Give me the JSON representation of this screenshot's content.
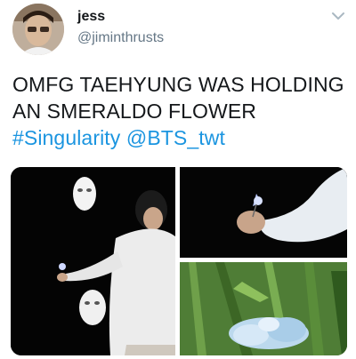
{
  "user": {
    "display_name": "jess",
    "handle": "@jiminthrusts"
  },
  "tweet": {
    "line1": "OMFG TAEHYUNG WAS HOLDING",
    "line2": "AN SMERALDO FLOWER",
    "hashtag": "#Singularity",
    "mention": "@BTS_twt"
  },
  "icons": {
    "menu": "chevron-down-icon"
  },
  "colors": {
    "text": "#14171a",
    "secondary": "#657786",
    "link": "#1b95e0"
  }
}
